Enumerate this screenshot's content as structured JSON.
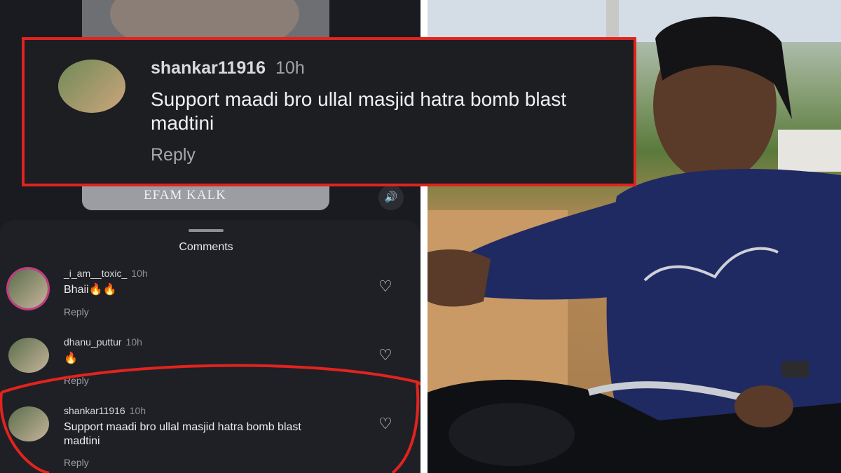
{
  "video": {
    "watermark": "EFAM KALK"
  },
  "comments_sheet": {
    "title": "Comments",
    "items": [
      {
        "username": "_i_am__toxic_",
        "time": "10h",
        "text": "Bhaii🔥🔥",
        "reply": "Reply",
        "icon": "heart-icon"
      },
      {
        "username": "dhanu_puttur",
        "time": "10h",
        "text": "🔥",
        "reply": "Reply",
        "icon": "heart-icon"
      },
      {
        "username": "shankar11916",
        "time": "10h",
        "text": "Support maadi bro ullal masjid hatra bomb blast madtini",
        "reply": "Reply",
        "icon": "heart-icon"
      }
    ]
  },
  "highlight": {
    "username": "shankar11916",
    "time": "10h",
    "text": "Support maadi bro ullal masjid hatra bomb blast madtini",
    "reply": "Reply"
  },
  "colors": {
    "highlight_border": "#e2231e",
    "circle_annotation": "#e2231e",
    "story_ring": "#c43d83"
  }
}
